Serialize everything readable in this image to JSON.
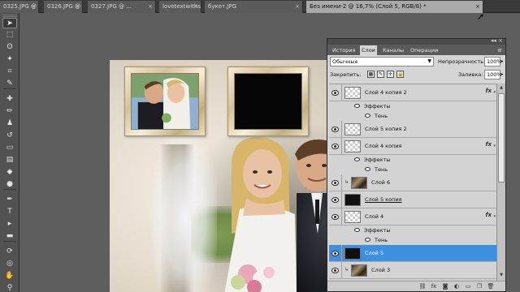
{
  "tabs": [
    {
      "label": "0325.JPG @ ...",
      "active": false
    },
    {
      "label": "0326.JPG @ ...",
      "active": false
    },
    {
      "label": "0327.JPG @ ...",
      "active": false
    },
    {
      "label": "lovetextwithswans copy.png",
      "active": false
    },
    {
      "label": "букет.JPG",
      "active": false
    },
    {
      "label": "Без имени-2 @ 16,7% (Слой 5, RGB/8) *",
      "active": true
    }
  ],
  "tab_close_glyph": "×",
  "tools": [
    {
      "icon": "move-icon",
      "glyph": "➤"
    },
    {
      "icon": "marquee-icon",
      "glyph": "⬚"
    },
    {
      "icon": "lasso-icon",
      "glyph": "ʘ"
    },
    {
      "icon": "magic-wand-icon",
      "glyph": "✦"
    },
    {
      "icon": "crop-icon",
      "glyph": "⌗"
    },
    {
      "icon": "eyedropper-icon",
      "glyph": "✎"
    },
    {
      "icon": "healing-brush-icon",
      "glyph": "✚"
    },
    {
      "icon": "brush-icon",
      "glyph": "✏"
    },
    {
      "icon": "clone-stamp-icon",
      "glyph": "♟"
    },
    {
      "icon": "history-brush-icon",
      "glyph": "↺"
    },
    {
      "icon": "eraser-icon",
      "glyph": "▭"
    },
    {
      "icon": "gradient-icon",
      "glyph": "▤"
    },
    {
      "icon": "blur-icon",
      "glyph": "◆"
    },
    {
      "icon": "dodge-icon",
      "glyph": "●"
    },
    {
      "icon": "pen-icon",
      "glyph": "✒"
    },
    {
      "icon": "type-icon",
      "glyph": "T"
    },
    {
      "icon": "path-selection-icon",
      "glyph": "▸"
    },
    {
      "icon": "shape-icon",
      "glyph": "▬"
    },
    {
      "icon": "3d-rotate-icon",
      "glyph": "⟳"
    },
    {
      "icon": "3d-orbit-icon",
      "glyph": "◎"
    },
    {
      "icon": "hand-icon",
      "glyph": "✋"
    },
    {
      "icon": "zoom-icon",
      "glyph": "⚲"
    }
  ],
  "panel": {
    "tabs": [
      "История",
      "Слои",
      "Каналы",
      "Операции"
    ],
    "active_tab": "Слои",
    "menu_glyph": "≡",
    "collapse_glyph": "◂◂ ×",
    "blend_mode": "Обычные",
    "opacity_label": "Непрозрачность:",
    "opacity_value": "100%",
    "lock_label": "Закрепить:",
    "fill_label": "Заливка:",
    "fill_value": "100%",
    "effects_label": "Эффекты",
    "shadow_label": "Тень",
    "fx_label": "fx"
  },
  "layers": [
    {
      "name": "Слой 4 копия 2",
      "thumb": "transparent",
      "fx": true,
      "linked": false,
      "underlined": false,
      "selected": false
    },
    {
      "name": "Слой 5 копия 2",
      "thumb": "transparent",
      "fx": false,
      "linked": false,
      "underlined": false,
      "selected": false
    },
    {
      "name": "Слой 4 копия",
      "thumb": "transparent",
      "fx": true,
      "linked": false,
      "underlined": false,
      "selected": false
    },
    {
      "name": "Слой 6",
      "thumb": "photo",
      "fx": false,
      "linked": true,
      "underlined": false,
      "selected": false
    },
    {
      "name": "Слой 5 копия",
      "thumb": "dark",
      "fx": false,
      "linked": false,
      "underlined": true,
      "selected": false
    },
    {
      "name": "Слой 4",
      "thumb": "transparent",
      "fx": true,
      "linked": false,
      "underlined": false,
      "selected": false
    },
    {
      "name": "Слой 5",
      "thumb": "dark",
      "fx": false,
      "linked": false,
      "underlined": false,
      "selected": true
    },
    {
      "name": "Слой 3",
      "thumb": "photo",
      "fx": false,
      "linked": true,
      "underlined": false,
      "selected": false
    }
  ],
  "footer_icons": [
    {
      "icon": "link-layers-icon",
      "glyph": "⛓"
    },
    {
      "icon": "layer-style-icon",
      "glyph": "fx"
    },
    {
      "icon": "layer-mask-icon",
      "glyph": "◙"
    },
    {
      "icon": "adjustment-layer-icon",
      "glyph": "◐"
    },
    {
      "icon": "new-group-icon",
      "glyph": "▭"
    },
    {
      "icon": "new-layer-icon",
      "glyph": "❐"
    },
    {
      "icon": "delete-layer-icon",
      "glyph": "🗑"
    }
  ],
  "lock_icons": [
    {
      "icon": "lock-transparency-icon",
      "glyph": "▦"
    },
    {
      "icon": "lock-pixels-icon",
      "glyph": "✎"
    },
    {
      "icon": "lock-position-icon",
      "glyph": "✛"
    },
    {
      "icon": "lock-all-icon",
      "glyph": "🔒"
    }
  ],
  "colors": {
    "selected_layer": "#3d8fe0",
    "workspace": "#5e5e5e",
    "panel_bg": "#d5d5d5"
  }
}
